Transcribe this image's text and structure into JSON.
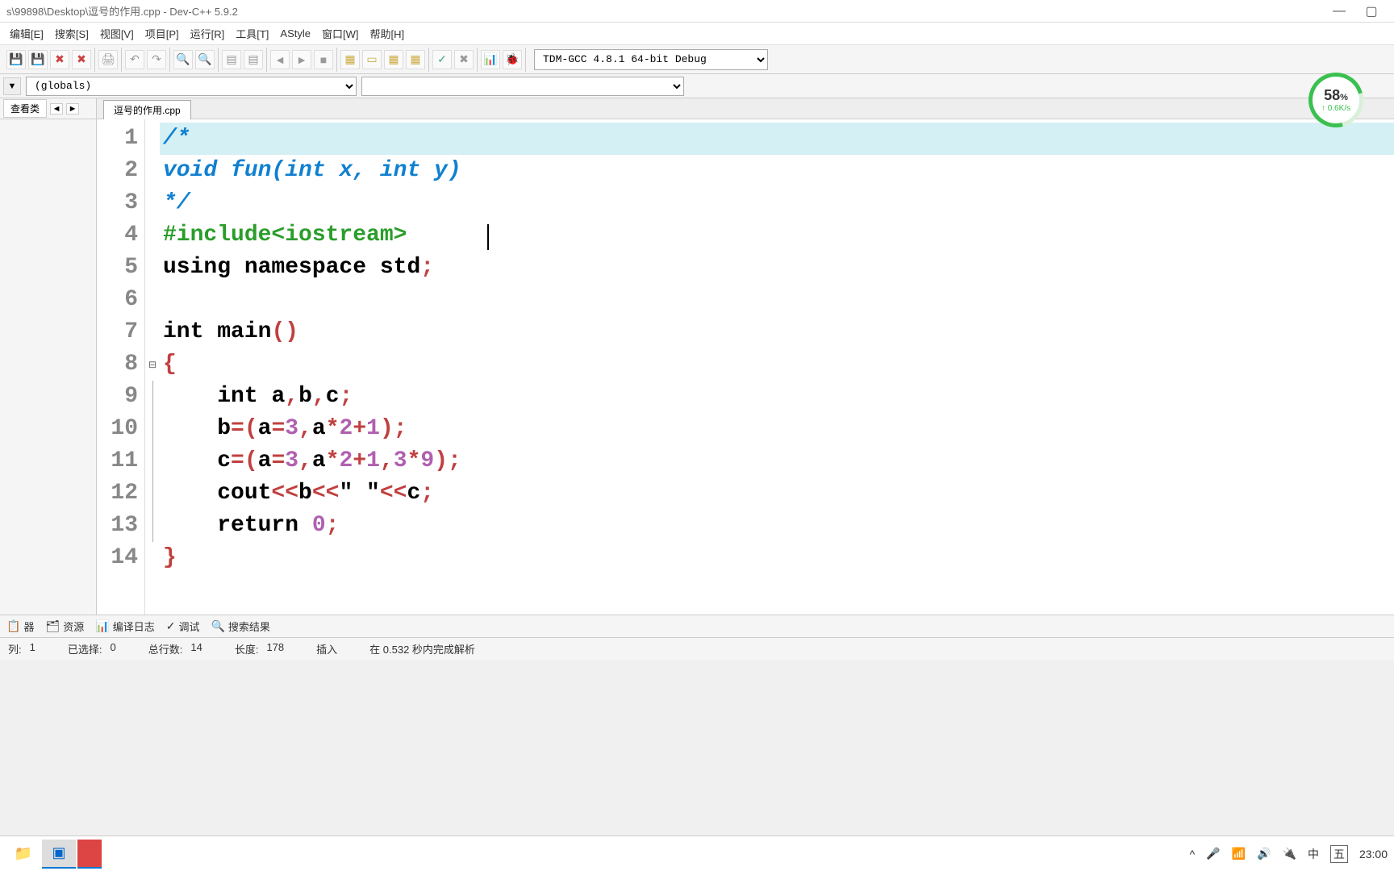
{
  "title": "s\\99898\\Desktop\\逗号的作用.cpp - Dev-C++ 5.9.2",
  "menu": [
    "编辑[E]",
    "搜索[S]",
    "视图[V]",
    "项目[P]",
    "运行[R]",
    "工具[T]",
    "AStyle",
    "窗口[W]",
    "帮助[H]"
  ],
  "compiler": "TDM-GCC 4.8.1 64-bit Debug",
  "globals": "(globals)",
  "sidebar_tab": "查看类",
  "file_tab": "逗号的作用.cpp",
  "code_lines": [
    {
      "n": "1",
      "hl": true,
      "tokens": [
        {
          "c": "c-comment",
          "t": "/*"
        }
      ]
    },
    {
      "n": "2",
      "tokens": [
        {
          "c": "c-comment",
          "t": "void fun(int x, int y)"
        }
      ]
    },
    {
      "n": "3",
      "tokens": [
        {
          "c": "c-comment",
          "t": "*/"
        }
      ]
    },
    {
      "n": "4",
      "tokens": [
        {
          "c": "c-pre",
          "t": "#include<iostream>"
        }
      ]
    },
    {
      "n": "5",
      "tokens": [
        {
          "c": "c-kw",
          "t": "using namespace "
        },
        {
          "c": "c-id",
          "t": "std"
        },
        {
          "c": "c-punc",
          "t": ";"
        }
      ]
    },
    {
      "n": "6",
      "tokens": [
        {
          "c": "c-id",
          "t": ""
        }
      ]
    },
    {
      "n": "7",
      "tokens": [
        {
          "c": "c-kw",
          "t": "int "
        },
        {
          "c": "c-id",
          "t": "main"
        },
        {
          "c": "c-punc",
          "t": "()"
        }
      ]
    },
    {
      "n": "8",
      "fold": "⊟",
      "tokens": [
        {
          "c": "c-punc",
          "t": "{"
        }
      ]
    },
    {
      "n": "9",
      "foldline": true,
      "tokens": [
        {
          "c": "c-id",
          "t": "    "
        },
        {
          "c": "c-kw",
          "t": "int "
        },
        {
          "c": "c-id",
          "t": "a"
        },
        {
          "c": "c-punc",
          "t": ","
        },
        {
          "c": "c-id",
          "t": "b"
        },
        {
          "c": "c-punc",
          "t": ","
        },
        {
          "c": "c-id",
          "t": "c"
        },
        {
          "c": "c-punc",
          "t": ";"
        }
      ]
    },
    {
      "n": "10",
      "foldline": true,
      "tokens": [
        {
          "c": "c-id",
          "t": "    b"
        },
        {
          "c": "c-punc",
          "t": "=("
        },
        {
          "c": "c-id",
          "t": "a"
        },
        {
          "c": "c-punc",
          "t": "="
        },
        {
          "c": "c-num",
          "t": "3"
        },
        {
          "c": "c-punc",
          "t": ","
        },
        {
          "c": "c-id",
          "t": "a"
        },
        {
          "c": "c-punc",
          "t": "*"
        },
        {
          "c": "c-num",
          "t": "2"
        },
        {
          "c": "c-punc",
          "t": "+"
        },
        {
          "c": "c-num",
          "t": "1"
        },
        {
          "c": "c-punc",
          "t": ");"
        }
      ]
    },
    {
      "n": "11",
      "foldline": true,
      "tokens": [
        {
          "c": "c-id",
          "t": "    c"
        },
        {
          "c": "c-punc",
          "t": "=("
        },
        {
          "c": "c-id",
          "t": "a"
        },
        {
          "c": "c-punc",
          "t": "="
        },
        {
          "c": "c-num",
          "t": "3"
        },
        {
          "c": "c-punc",
          "t": ","
        },
        {
          "c": "c-id",
          "t": "a"
        },
        {
          "c": "c-punc",
          "t": "*"
        },
        {
          "c": "c-num",
          "t": "2"
        },
        {
          "c": "c-punc",
          "t": "+"
        },
        {
          "c": "c-num",
          "t": "1"
        },
        {
          "c": "c-punc",
          "t": ","
        },
        {
          "c": "c-num",
          "t": "3"
        },
        {
          "c": "c-punc",
          "t": "*"
        },
        {
          "c": "c-num",
          "t": "9"
        },
        {
          "c": "c-punc",
          "t": ");"
        }
      ]
    },
    {
      "n": "12",
      "foldline": true,
      "tokens": [
        {
          "c": "c-id",
          "t": "    cout"
        },
        {
          "c": "c-punc",
          "t": "<<"
        },
        {
          "c": "c-id",
          "t": "b"
        },
        {
          "c": "c-punc",
          "t": "<<"
        },
        {
          "c": "c-id",
          "t": "\" \""
        },
        {
          "c": "c-punc",
          "t": "<<"
        },
        {
          "c": "c-id",
          "t": "c"
        },
        {
          "c": "c-punc",
          "t": ";"
        }
      ]
    },
    {
      "n": "13",
      "foldline": true,
      "tokens": [
        {
          "c": "c-id",
          "t": "    "
        },
        {
          "c": "c-kw",
          "t": "return "
        },
        {
          "c": "c-num",
          "t": "0"
        },
        {
          "c": "c-punc",
          "t": ";"
        }
      ]
    },
    {
      "n": "14",
      "tokens": [
        {
          "c": "c-punc",
          "t": "}"
        }
      ]
    }
  ],
  "bottom_tabs": [
    {
      "icon": "📋",
      "label": "器"
    },
    {
      "icon": "🗂",
      "label": "资源"
    },
    {
      "icon": "📊",
      "label": "编译日志"
    },
    {
      "icon": "✓",
      "label": "调试"
    },
    {
      "icon": "🔍",
      "label": "搜索结果"
    }
  ],
  "status": {
    "col_label": "列:",
    "col": "1",
    "sel_label": "已选择:",
    "sel": "0",
    "lines_label": "总行数:",
    "lines": "14",
    "len_label": "长度:",
    "len": "178",
    "mode": "插入",
    "parse": "在 0.532 秒内完成解析"
  },
  "speed": {
    "pct": "58",
    "unit": "%",
    "rate": "↑ 0.6K/s"
  },
  "tray": {
    "ime": "中",
    "day": "五",
    "clock": "23:00"
  }
}
